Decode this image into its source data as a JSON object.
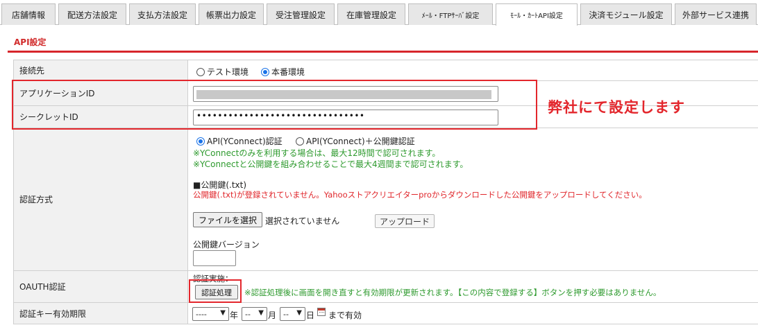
{
  "tabs": [
    {
      "label": "店舗情報"
    },
    {
      "label": "配送方法設定"
    },
    {
      "label": "支払方法設定"
    },
    {
      "label": "帳票出力設定"
    },
    {
      "label": "受注管理設定"
    },
    {
      "label": "在庫管理設定"
    },
    {
      "label": "ﾒｰﾙ・FTPｻｰﾊﾞ設定"
    },
    {
      "label": "ﾓｰﾙ・ｶｰﾄAPI設定",
      "active": true
    },
    {
      "label": "決済モジュール設定"
    },
    {
      "label": "外部サービス連携"
    }
  ],
  "section": {
    "title": "API設定"
  },
  "rows": {
    "connection": {
      "label": "接続先",
      "options": [
        "テスト環境",
        "本番環境"
      ],
      "selected": "本番環境"
    },
    "app_id": {
      "label": "アプリケーションID",
      "value_masked": true
    },
    "secret_id": {
      "label": "シークレットID",
      "value": "••••••••••••••••••••••••••••••••"
    },
    "auth_method": {
      "label": "認証方式",
      "options": [
        "API(YConnect)認証",
        "API(YConnect)＋公開鍵認証"
      ],
      "selected": "API(YConnect)認証",
      "note1": "※YConnectのみを利用する場合は、最大12時間で認可されます。",
      "note2": "※YConnectと公開鍵を組み合わせることで最大4週間まで認可されます。",
      "pubkey_heading": "■公開鍵(.txt)",
      "pubkey_error": "公開鍵(.txt)が登録されていません。Yahooストアクリエイターproからダウンロードした公開鍵をアップロードしてください。",
      "file_button": "ファイルを選択",
      "file_status": "選択されていません",
      "upload_button": "アップロード",
      "version_label": "公開鍵バージョン",
      "version_value": ""
    },
    "oauth": {
      "label": "OAUTH認証",
      "status_label": "認証実施：",
      "auth_button": "認証処理",
      "note": "※認証処理後に画面を開き直すと有効期限が更新されます。【この内容で登録する】ボタンを押す必要はありません。"
    },
    "expiry": {
      "label": "認証キー有効期限",
      "year_value": "----",
      "year_unit": "年",
      "month_value": "--",
      "month_unit": "月",
      "day_value": "--",
      "day_unit": "日",
      "suffix": "まで有効"
    }
  },
  "annotation": {
    "text": "弊社にて設定します"
  },
  "colors": {
    "accent": "#d7262b",
    "note_green": "#2e9a2e",
    "error_red": "#e0262b",
    "highlight_box": "#e3262c"
  }
}
